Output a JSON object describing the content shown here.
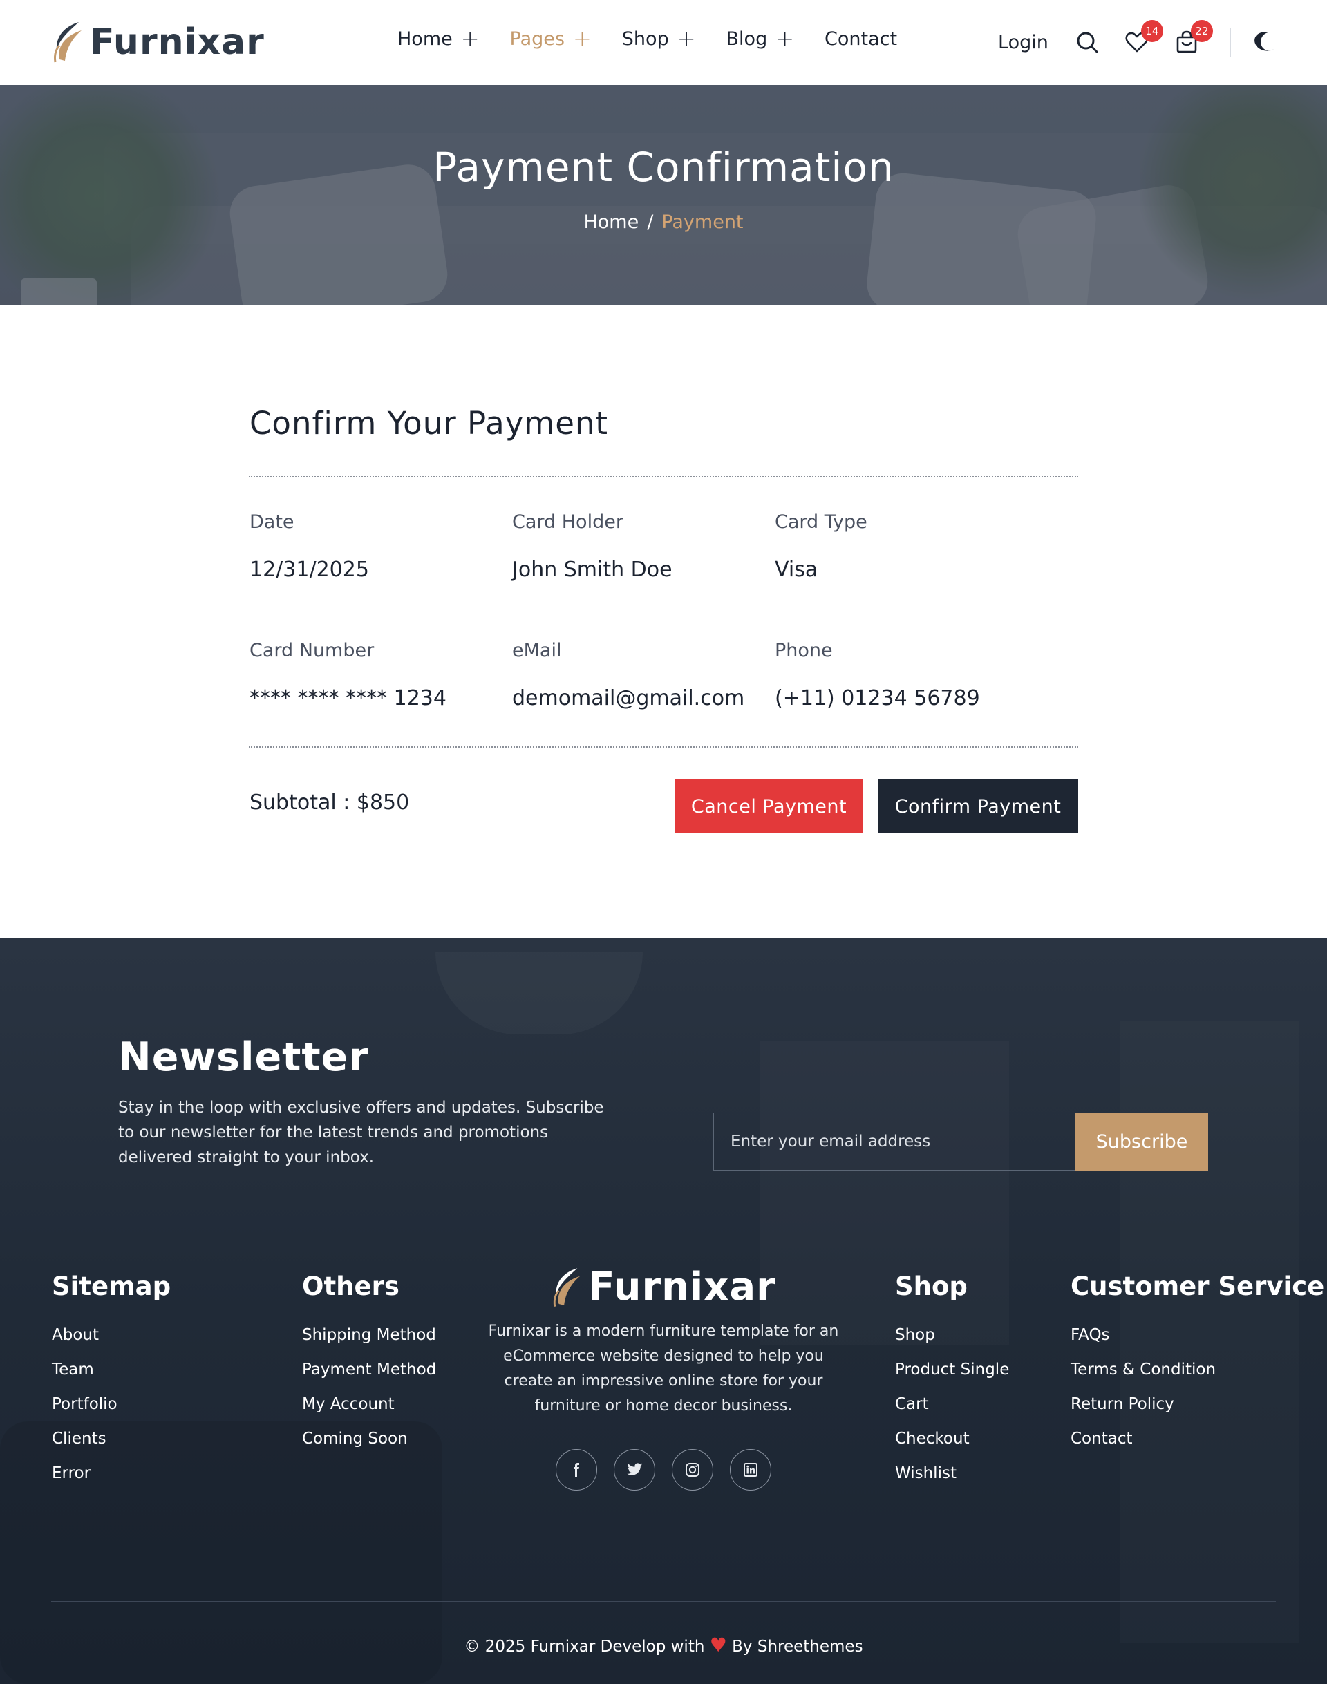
{
  "brand": {
    "name": "Furnixar",
    "accent": "#c49a6c",
    "dark": "#1e2633",
    "danger": "#e3393a"
  },
  "nav": {
    "items": [
      {
        "label": "Home",
        "has_submenu": true,
        "active": false
      },
      {
        "label": "Pages",
        "has_submenu": true,
        "active": true
      },
      {
        "label": "Shop",
        "has_submenu": true,
        "active": false
      },
      {
        "label": "Blog",
        "has_submenu": true,
        "active": false
      },
      {
        "label": "Contact",
        "has_submenu": false,
        "active": false
      }
    ],
    "plus": "+",
    "login": "Login",
    "wishlist_count": "14",
    "cart_count": "22",
    "icons": [
      "search-icon",
      "heart-icon",
      "shopping-bag-icon",
      "moon-icon"
    ]
  },
  "hero": {
    "title": "Payment Confirmation",
    "breadcrumb": {
      "home": "Home",
      "separator": "/",
      "current": "Payment"
    }
  },
  "payment": {
    "title": "Confirm Your Payment",
    "fields": [
      {
        "label": "Date",
        "value": "12/31/2025"
      },
      {
        "label": "Card Holder",
        "value": "John Smith Doe"
      },
      {
        "label": "Card Type",
        "value": "Visa"
      },
      {
        "label": "Card Number",
        "value": "**** **** **** 1234"
      },
      {
        "label": "eMail",
        "value": "demomail@gmail.com"
      },
      {
        "label": "Phone",
        "value": "(+11) 01234 56789"
      }
    ],
    "subtotal": "Subtotal : $850",
    "cancel_label": "Cancel Payment",
    "confirm_label": "Confirm Payment"
  },
  "newsletter": {
    "title": "Newsletter",
    "text": "Stay in the loop with exclusive offers and updates. Subscribe to our newsletter for the latest trends and promotions delivered straight to your inbox.",
    "placeholder": "Enter your email address",
    "button": "Subscribe"
  },
  "footer": {
    "sitemap": {
      "title": "Sitemap",
      "links": [
        "About",
        "Team",
        "Portfolio",
        "Clients",
        "Error"
      ]
    },
    "others": {
      "title": "Others",
      "links": [
        "Shipping Method",
        "Payment Method",
        "My Account",
        "Coming Soon"
      ]
    },
    "brand_desc": "Furnixar is a modern furniture template for an eCommerce website designed to help you create an impressive online store for your furniture or home decor business.",
    "socials": [
      "facebook-icon",
      "twitter-icon",
      "instagram-icon",
      "linkedin-icon"
    ],
    "shop": {
      "title": "Shop",
      "links": [
        "Shop",
        "Product Single",
        "Cart",
        "Checkout",
        "Wishlist"
      ]
    },
    "service": {
      "title": "Customer Service",
      "links": [
        "FAQs",
        "Terms & Condition",
        "Return Policy",
        "Contact"
      ]
    },
    "copyright_pre": "© 2025 Furnixar Develop with",
    "copyright_post": "By Shreethemes"
  }
}
